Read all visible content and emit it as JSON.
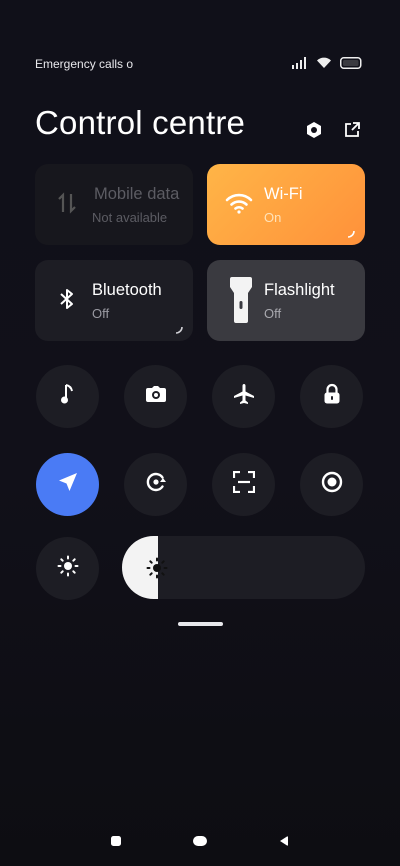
{
  "status_bar": {
    "carrier_text": "Emergency calls o",
    "signal_icon": "signal-bars-icon",
    "wifi_icon": "wifi-icon",
    "battery_icon": "battery-icon"
  },
  "header": {
    "title": "Control centre",
    "settings_icon": "gear-icon",
    "edit_icon": "edit-icon"
  },
  "tiles": [
    {
      "key": "mobile-data",
      "name": "Mobile data",
      "status": "Not available",
      "icon": "mobile-data-icon",
      "state": "disabled"
    },
    {
      "key": "wifi",
      "name": "Wi-Fi",
      "status": "On",
      "icon": "wifi-icon",
      "state": "active"
    },
    {
      "key": "bluetooth",
      "name": "Bluetooth",
      "status": "Off",
      "icon": "bluetooth-icon",
      "state": "off"
    },
    {
      "key": "flashlight",
      "name": "Flashlight",
      "status": "Off",
      "icon": "flashlight-icon",
      "state": "off"
    }
  ],
  "toggles_row1": [
    {
      "key": "sound",
      "icon": "music-note-icon"
    },
    {
      "key": "screenshot",
      "icon": "camera-icon"
    },
    {
      "key": "airplane",
      "icon": "airplane-icon"
    },
    {
      "key": "lock",
      "icon": "lock-icon"
    }
  ],
  "toggles_row2": [
    {
      "key": "location",
      "icon": "location-arrow-icon",
      "state": "active"
    },
    {
      "key": "rotation",
      "icon": "rotation-lock-icon"
    },
    {
      "key": "scanner",
      "icon": "scan-frame-icon"
    },
    {
      "key": "record",
      "icon": "screen-record-icon"
    }
  ],
  "brightness": {
    "level": 0.15,
    "icon": "brightness-icon"
  },
  "colors": {
    "wifi_gradient_start": "#ffb547",
    "wifi_gradient_end": "#ff913a",
    "location_active": "#4a7bf5",
    "tile_off": "#1d1d24",
    "flashlight_tile": "#3a3a40"
  },
  "nav_bar": {
    "recents_icon": "recents-square-icon",
    "home_icon": "home-pill-icon",
    "back_icon": "back-triangle-icon"
  }
}
